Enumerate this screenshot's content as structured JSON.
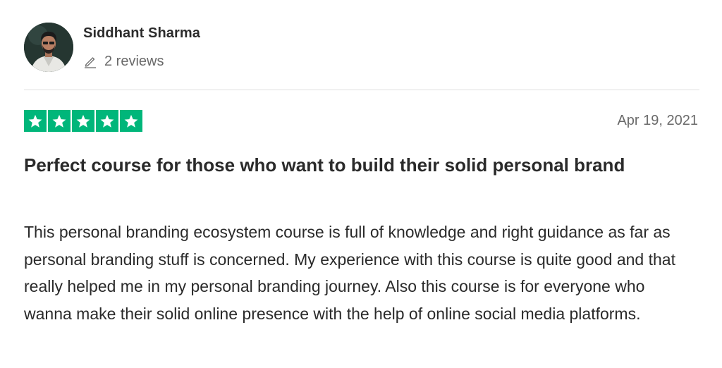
{
  "reviewer": {
    "name": "Siddhant Sharma",
    "reviews_label": "2 reviews"
  },
  "review": {
    "rating": 5,
    "rating_max": 5,
    "date": "Apr 19, 2021",
    "title": "Perfect course for those who want to build their solid personal brand",
    "body": "This personal branding ecosystem course is full of knowledge and right guidance as far as personal branding stuff is concerned. My experience with this course is quite good and that really helped me in my personal branding journey. Also this course is for everyone who wanna make their solid online presence with the help of online social media platforms."
  },
  "colors": {
    "star_fill": "#00b67a",
    "star_glyph": "#ffffff",
    "muted_text": "#6a6a6a",
    "divider": "#dedede"
  },
  "icons": {
    "edit": "pencil-icon",
    "rating": "star-icon"
  }
}
